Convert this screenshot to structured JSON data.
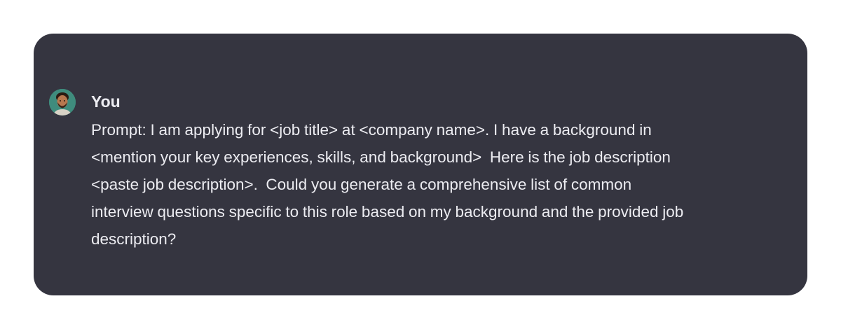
{
  "message": {
    "author": "You",
    "avatar_icon": "user-avatar-photo",
    "lines": [
      "Prompt: I am applying for <job title> at <company name>. I have a background in",
      "<mention your key experiences, skills, and background>  Here is the job description",
      "<paste job description>.  Could you generate a comprehensive list of common",
      "interview questions specific to this role based on my background and the provided job",
      "description?"
    ]
  },
  "colors": {
    "card_background": "#353540",
    "text": "#ececf1",
    "avatar_background": "#3f8c7d"
  }
}
